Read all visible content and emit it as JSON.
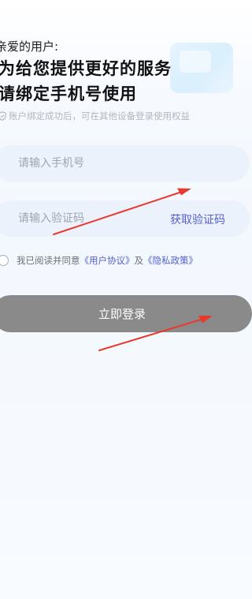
{
  "header": {
    "greeting": "亲爱的用户:",
    "headline_line1": "为给您提供更好的服务",
    "headline_line2": "请绑定手机号使用"
  },
  "hint": {
    "icon": "shield-icon",
    "text": "账户绑定成功后，可在其他设备登录使用权益"
  },
  "form": {
    "phone_placeholder": "请输入手机号",
    "code_placeholder": "请输入验证码",
    "get_code_label": "获取验证码"
  },
  "agreement": {
    "prefix": "我已阅读并同意",
    "user_agreement": "《用户协议》",
    "conjunction": "及",
    "privacy_policy": "《隐私政策》"
  },
  "login_button": {
    "label": "立即登录"
  },
  "colors": {
    "accent": "#5460cf",
    "button_disabled": "#8a8a8a",
    "field_bg": "#ecf2fb",
    "annotation_arrow": "#e8392d"
  }
}
